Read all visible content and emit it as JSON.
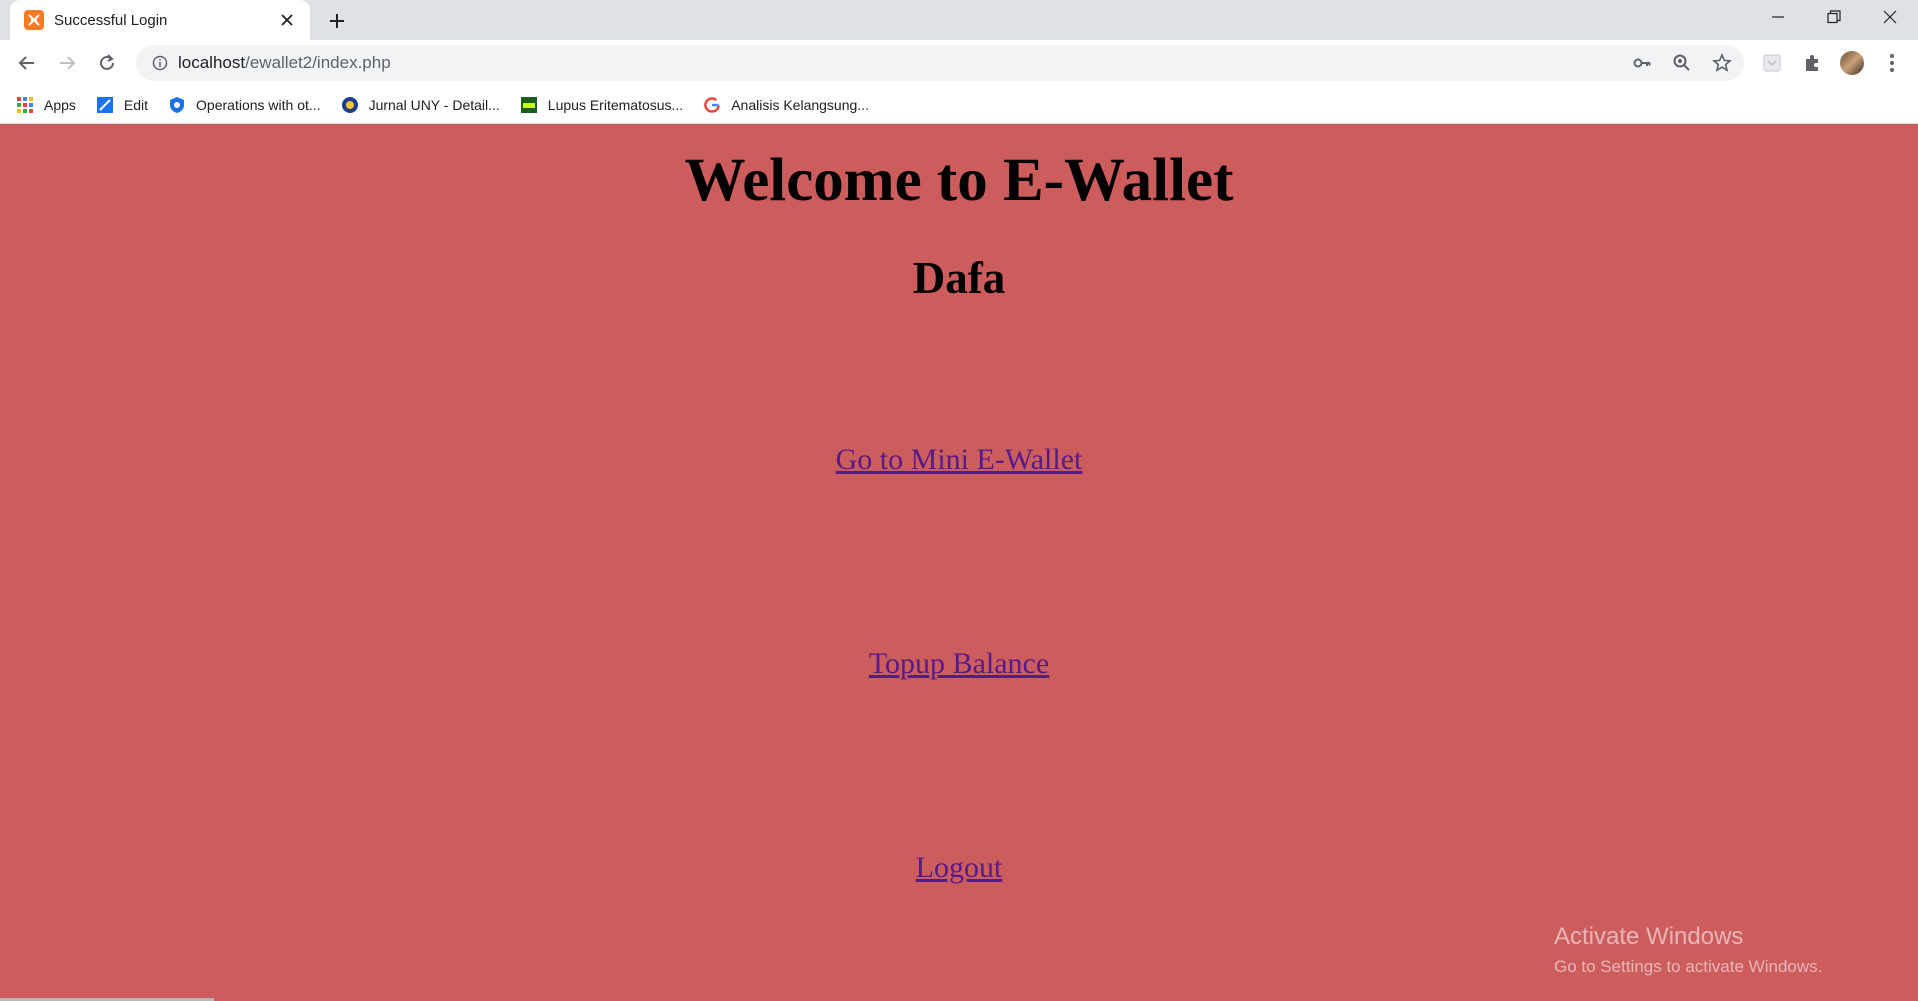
{
  "browser": {
    "tab": {
      "title": "Successful Login"
    },
    "address": {
      "host": "localhost",
      "path": "/ewallet2/index.php"
    },
    "bookmarks": [
      {
        "label": "Apps",
        "icon": "apps-grid-icon"
      },
      {
        "label": "Edit",
        "icon": "edit-site-icon"
      },
      {
        "label": "Operations with ot...",
        "icon": "shield-icon"
      },
      {
        "label": "Jurnal UNY - Detail...",
        "icon": "uny-logo-icon"
      },
      {
        "label": "Lupus Eritematosus...",
        "icon": "jka-logo-icon"
      },
      {
        "label": "Analisis Kelangsung...",
        "icon": "google-icon"
      }
    ]
  },
  "page": {
    "title": "Welcome to E-Wallet",
    "username": "Dafa",
    "links": {
      "mini_wallet": "Go to Mini E-Wallet",
      "topup": "Topup Balance",
      "logout": "Logout"
    },
    "link_color": "#551a8b",
    "background_color": "#cd5c5c"
  },
  "watermark": {
    "line1": "Activate Windows",
    "line2": "Go to Settings to activate Windows."
  }
}
